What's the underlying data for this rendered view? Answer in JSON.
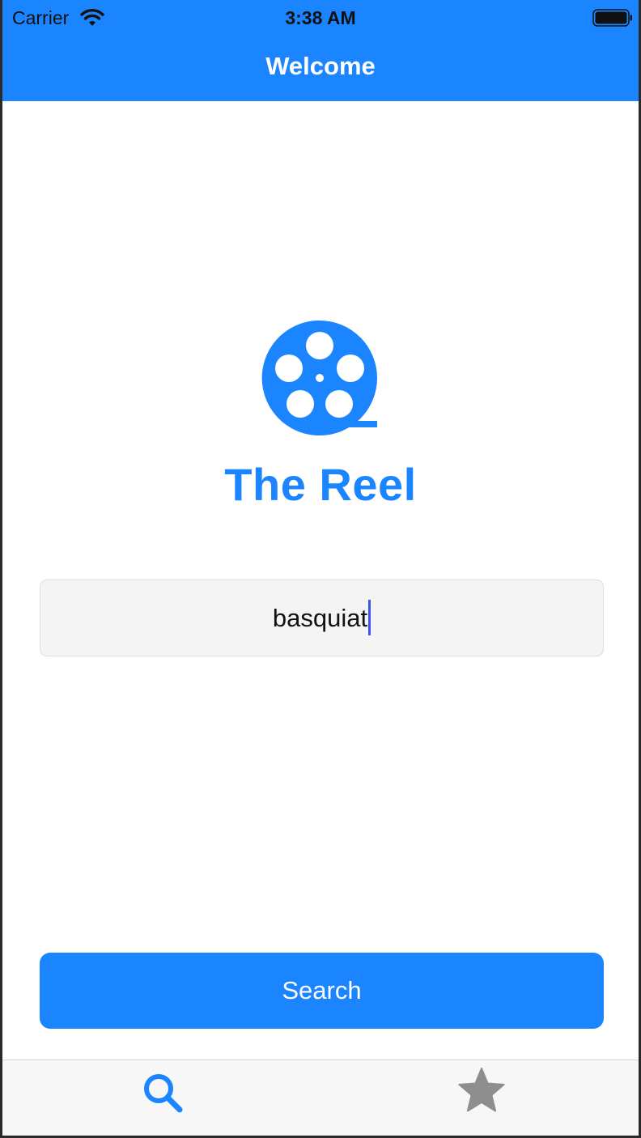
{
  "status_bar": {
    "carrier": "Carrier",
    "time": "3:38 AM",
    "icons": [
      "wifi-icon",
      "battery-icon"
    ]
  },
  "nav": {
    "title": "Welcome"
  },
  "logo": {
    "icon": "film-reel-icon",
    "app_name": "The Reel"
  },
  "search": {
    "value": "basquiat",
    "button_label": "Search"
  },
  "tab_bar": {
    "tabs": [
      {
        "icon": "search-icon",
        "selected": true
      },
      {
        "icon": "star-icon",
        "selected": false
      }
    ]
  },
  "colors": {
    "accent": "#1a85ff",
    "tab_inactive": "#8e8e8e",
    "field_background": "#f4f4f4",
    "caret": "#3a55e8"
  }
}
